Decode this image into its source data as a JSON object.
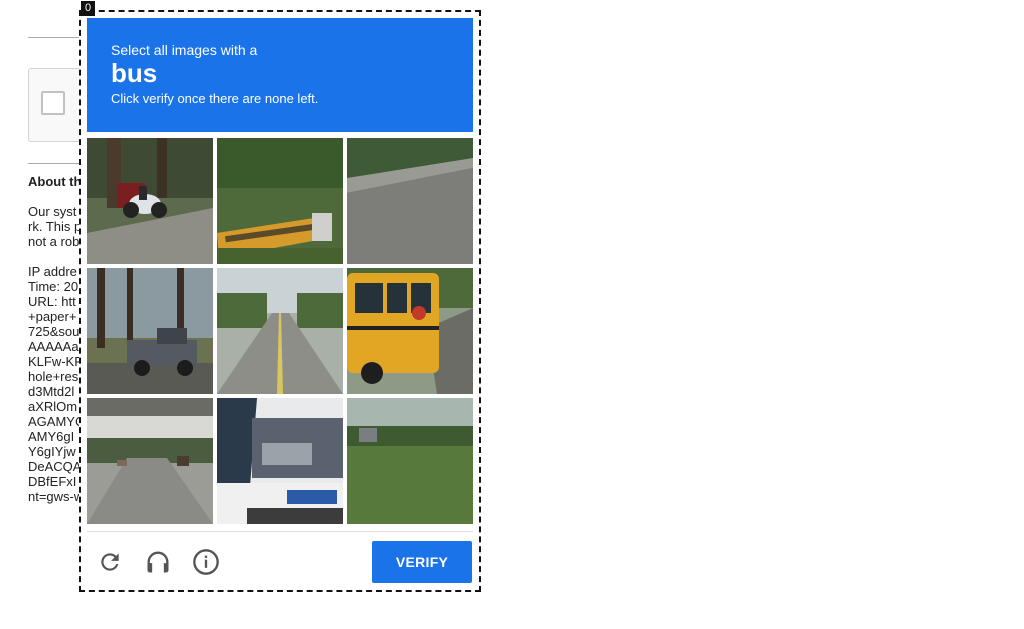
{
  "frame_index": "0",
  "challenge": {
    "prompt_line1": "Select all images with a",
    "target": "bus",
    "prompt_line3": "Click verify once there are none left."
  },
  "tiles": [
    {
      "name": "tile-1-motorcycle-road",
      "selected": false
    },
    {
      "name": "tile-2-school-bus-grass",
      "selected": false
    },
    {
      "name": "tile-3-guardrail-road",
      "selected": false
    },
    {
      "name": "tile-4-pickup-truck",
      "selected": false
    },
    {
      "name": "tile-5-empty-road",
      "selected": false
    },
    {
      "name": "tile-6-school-bus",
      "selected": false
    },
    {
      "name": "tile-7-overpass-road",
      "selected": false
    },
    {
      "name": "tile-8-city-bus",
      "selected": false
    },
    {
      "name": "tile-9-grass-field",
      "selected": false
    }
  ],
  "footer": {
    "reload_icon": "reload-icon",
    "audio_icon": "headphones-icon",
    "info_icon": "info-icon",
    "verify_label": "VERIFY"
  },
  "background": {
    "heading": "About th",
    "paragraph": [
      "Our syst",
      "rk. This p",
      "not a rob"
    ],
    "details": [
      "IP addre",
      "Time: 20",
      "URL: htt",
      "+paper+",
      "725&sou",
      "AAAAAa",
      "KLFw-KF",
      "hole+res",
      "d3Mtd2l",
      "aXRlOm",
      "AGAMYC",
      "AMY6gI",
      "Y6gIYjw",
      "DeACQA",
      "DBfEFxI",
      "nt=gws-w"
    ]
  },
  "colors": {
    "accent": "#1a73e8"
  }
}
